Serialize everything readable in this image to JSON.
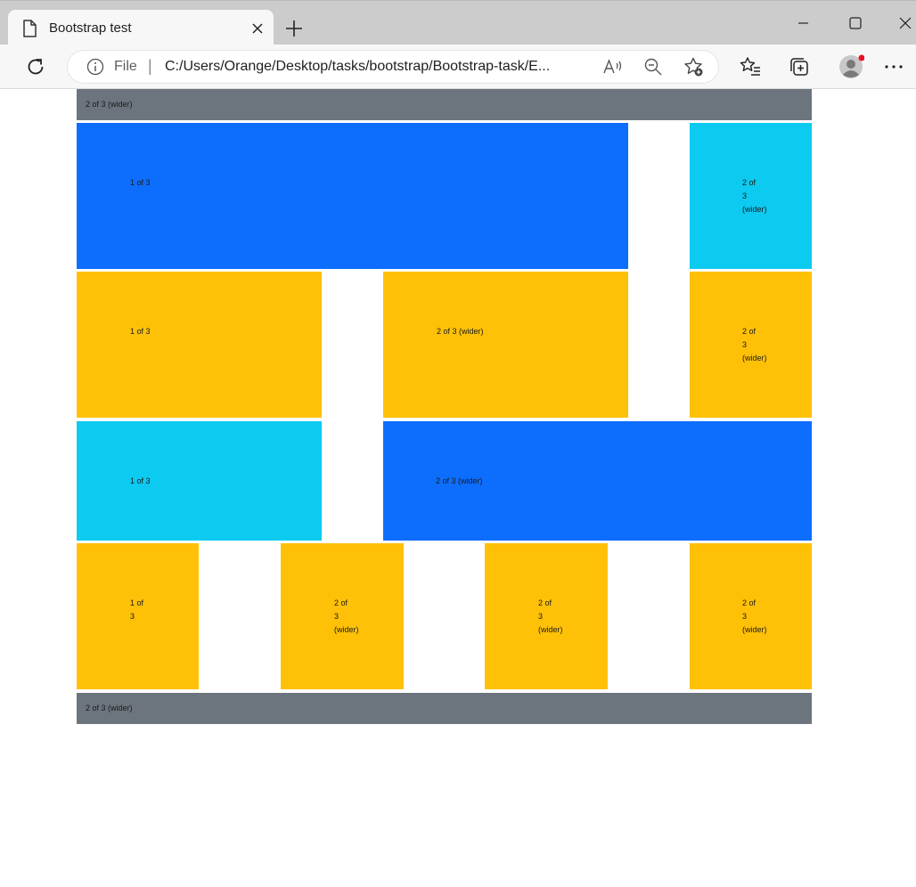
{
  "browser": {
    "tab_title": "Bootstrap test",
    "address": {
      "scheme_label": "File",
      "separator": "|",
      "url": "C:/Users/Orange/Desktop/tasks/bootstrap/Bootstrap-task/E..."
    },
    "icons": {
      "tab": "page-icon",
      "close": "close-icon",
      "new_tab": "plus-icon",
      "reload": "reload-icon",
      "info": "info-icon",
      "read_aloud": "read-aloud-icon",
      "zoom": "zoom-out-icon",
      "add_favorite": "add-favorite-icon",
      "favorites": "favorites-icon",
      "collections": "collections-icon",
      "profile": "profile-avatar",
      "menu": "more-icon"
    }
  },
  "colors": {
    "gray": "#6c757d",
    "blue": "#0d6efd",
    "cyan": "#0dcaf0",
    "yellow": "#ffc107",
    "notification_dot": "#e81123"
  },
  "grid": {
    "top_bar": {
      "text": "2 of 3 (wider)"
    },
    "row1": {
      "col1": {
        "text": "1 of 3"
      },
      "col2": {
        "lines": [
          "2 of",
          "3",
          "(wider)"
        ]
      }
    },
    "row2": {
      "col1": {
        "text": "1 of 3"
      },
      "col2": {
        "text": "2 of 3 (wider)"
      },
      "col3": {
        "lines": [
          "2 of",
          "3",
          "(wider)"
        ]
      }
    },
    "row3": {
      "col1": {
        "text": "1 of 3"
      },
      "col2": {
        "text": "2 of 3 (wider)"
      }
    },
    "row4": {
      "col1": {
        "lines": [
          "1 of",
          "3"
        ]
      },
      "col2": {
        "lines": [
          "2 of",
          "3",
          "(wider)"
        ]
      },
      "col3": {
        "lines": [
          "2 of",
          "3",
          "(wider)"
        ]
      },
      "col4": {
        "lines": [
          "2 of",
          "3",
          "(wider)"
        ]
      }
    },
    "bottom_bar": {
      "text": "2 of 3 (wider)"
    }
  }
}
